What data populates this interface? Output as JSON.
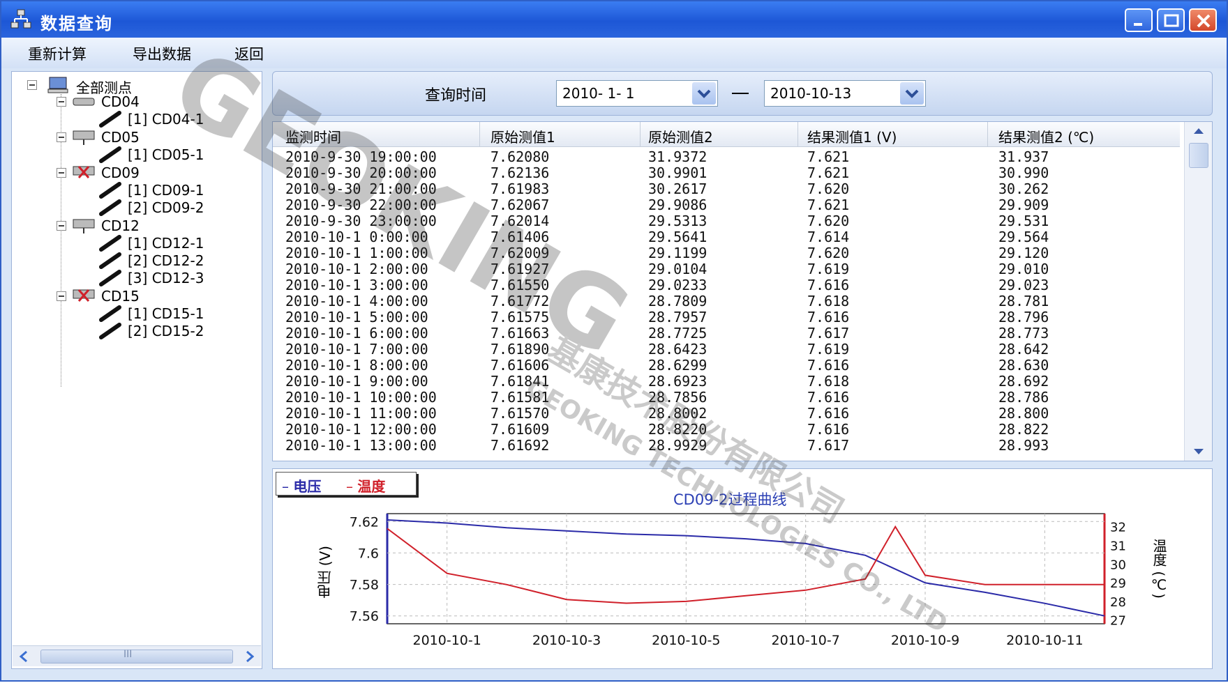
{
  "window": {
    "title": "数据查询",
    "icon": "app-tree-icon",
    "controls": [
      "minimize-icon",
      "maximize-icon",
      "close-icon"
    ]
  },
  "menu": {
    "items": [
      "重新计算",
      "导出数据",
      "返回"
    ]
  },
  "tree": {
    "root": "全部测点",
    "groups": [
      {
        "label": "CD04",
        "children": [
          "[1]  CD04-1"
        ]
      },
      {
        "label": "CD05",
        "children": [
          "[1]  CD05-1"
        ]
      },
      {
        "label": "CD09",
        "children": [
          "[1]  CD09-1",
          "[2]  CD09-2"
        ]
      },
      {
        "label": "CD12",
        "children": [
          "[1]  CD12-1",
          "[2]  CD12-2",
          "[3]  CD12-3"
        ]
      },
      {
        "label": "CD15",
        "children": [
          "[1]  CD15-1",
          "[2]  CD15-2"
        ]
      }
    ],
    "scroll_thumb_text": "III"
  },
  "query": {
    "label": "查询时间",
    "start": "2010- 1- 1",
    "separator": "—",
    "end": "2010-10-13"
  },
  "table": {
    "headers": [
      "监测时间",
      "原始测值1",
      "原始测值2",
      "结果测值1 (V)",
      "结果测值2 (℃)"
    ],
    "rows": [
      [
        "2010-9-30 19:00:00",
        "7.62080",
        "31.9372",
        "7.621",
        "31.937"
      ],
      [
        "2010-9-30 20:00:00",
        "7.62136",
        "30.9901",
        "7.621",
        "30.990"
      ],
      [
        "2010-9-30 21:00:00",
        "7.61983",
        "30.2617",
        "7.620",
        "30.262"
      ],
      [
        "2010-9-30 22:00:00",
        "7.62067",
        "29.9086",
        "7.621",
        "29.909"
      ],
      [
        "2010-9-30 23:00:00",
        "7.62014",
        "29.5313",
        "7.620",
        "29.531"
      ],
      [
        "2010-10-1 0:00:00",
        "7.61406",
        "29.5641",
        "7.614",
        "29.564"
      ],
      [
        "2010-10-1 1:00:00",
        "7.62009",
        "29.1199",
        "7.620",
        "29.120"
      ],
      [
        "2010-10-1 2:00:00",
        "7.61927",
        "29.0104",
        "7.619",
        "29.010"
      ],
      [
        "2010-10-1 3:00:00",
        "7.61550",
        "29.0233",
        "7.616",
        "29.023"
      ],
      [
        "2010-10-1 4:00:00",
        "7.61772",
        "28.7809",
        "7.618",
        "28.781"
      ],
      [
        "2010-10-1 5:00:00",
        "7.61575",
        "28.7957",
        "7.616",
        "28.796"
      ],
      [
        "2010-10-1 6:00:00",
        "7.61663",
        "28.7725",
        "7.617",
        "28.773"
      ],
      [
        "2010-10-1 7:00:00",
        "7.61890",
        "28.6423",
        "7.619",
        "28.642"
      ],
      [
        "2010-10-1 8:00:00",
        "7.61606",
        "28.6299",
        "7.616",
        "28.630"
      ],
      [
        "2010-10-1 9:00:00",
        "7.61841",
        "28.6923",
        "7.618",
        "28.692"
      ],
      [
        "2010-10-1 10:00:00",
        "7.61581",
        "28.7856",
        "7.616",
        "28.786"
      ],
      [
        "2010-10-1 11:00:00",
        "7.61570",
        "28.8002",
        "7.616",
        "28.800"
      ],
      [
        "2010-10-1 12:00:00",
        "7.61609",
        "28.8220",
        "7.616",
        "28.822"
      ],
      [
        "2010-10-1 13:00:00",
        "7.61692",
        "28.9929",
        "7.617",
        "28.993"
      ]
    ]
  },
  "chart_data": {
    "type": "line",
    "title": "CD09-2过程曲线",
    "legend": [
      {
        "name": "电压",
        "color": "#2a2aa8"
      },
      {
        "name": "温度",
        "color": "#d0202a"
      }
    ],
    "legend_placement": "top-left",
    "x_ticks": [
      "2010-10-1",
      "2010-10-3",
      "2010-10-5",
      "2010-10-7",
      "2010-10-9",
      "2010-10-11"
    ],
    "xlim": [
      "2010-9-30",
      "2010-10-12"
    ],
    "ylabel_left": "电压 (V)",
    "ylim_left": [
      7.555,
      7.625
    ],
    "yticks_left": [
      7.62,
      7.6,
      7.58,
      7.56
    ],
    "ylabel_right": "温度 (℃)",
    "ylim_right": [
      26.8,
      32.7
    ],
    "yticks_right": [
      32,
      31,
      30,
      29,
      28,
      27
    ],
    "grid": true,
    "series": [
      {
        "name": "电压",
        "color": "#2a2aa8",
        "x": [
          "2010-9-30",
          "2010-10-1",
          "2010-10-2",
          "2010-10-3",
          "2010-10-4",
          "2010-10-5",
          "2010-10-6",
          "2010-10-7",
          "2010-10-8",
          "2010-10-9",
          "2010-10-10",
          "2010-10-11",
          "2010-10-12"
        ],
        "values": [
          7.621,
          7.619,
          7.616,
          7.614,
          7.612,
          7.611,
          7.609,
          7.606,
          7.5985,
          7.581,
          7.575,
          7.568,
          7.56
        ]
      },
      {
        "name": "温度",
        "color": "#d0202a",
        "x": [
          "2010-9-30",
          "2010-10-1",
          "2010-10-2",
          "2010-10-3",
          "2010-10-4",
          "2010-10-5",
          "2010-10-6",
          "2010-10-7",
          "2010-10-8",
          "2010-10-8.5",
          "2010-10-9",
          "2010-10-10",
          "2010-10-11",
          "2010-10-12"
        ],
        "values": [
          31.9,
          29.5,
          28.9,
          28.1,
          27.9,
          28.0,
          28.3,
          28.6,
          29.2,
          32.0,
          29.4,
          28.9,
          28.9,
          28.9
        ]
      }
    ]
  },
  "watermark": {
    "brand": "GEOKING",
    "cn": "基康技术股份有限公司",
    "en": "GEOKING TECHNOLOGIES CO., LTD"
  }
}
